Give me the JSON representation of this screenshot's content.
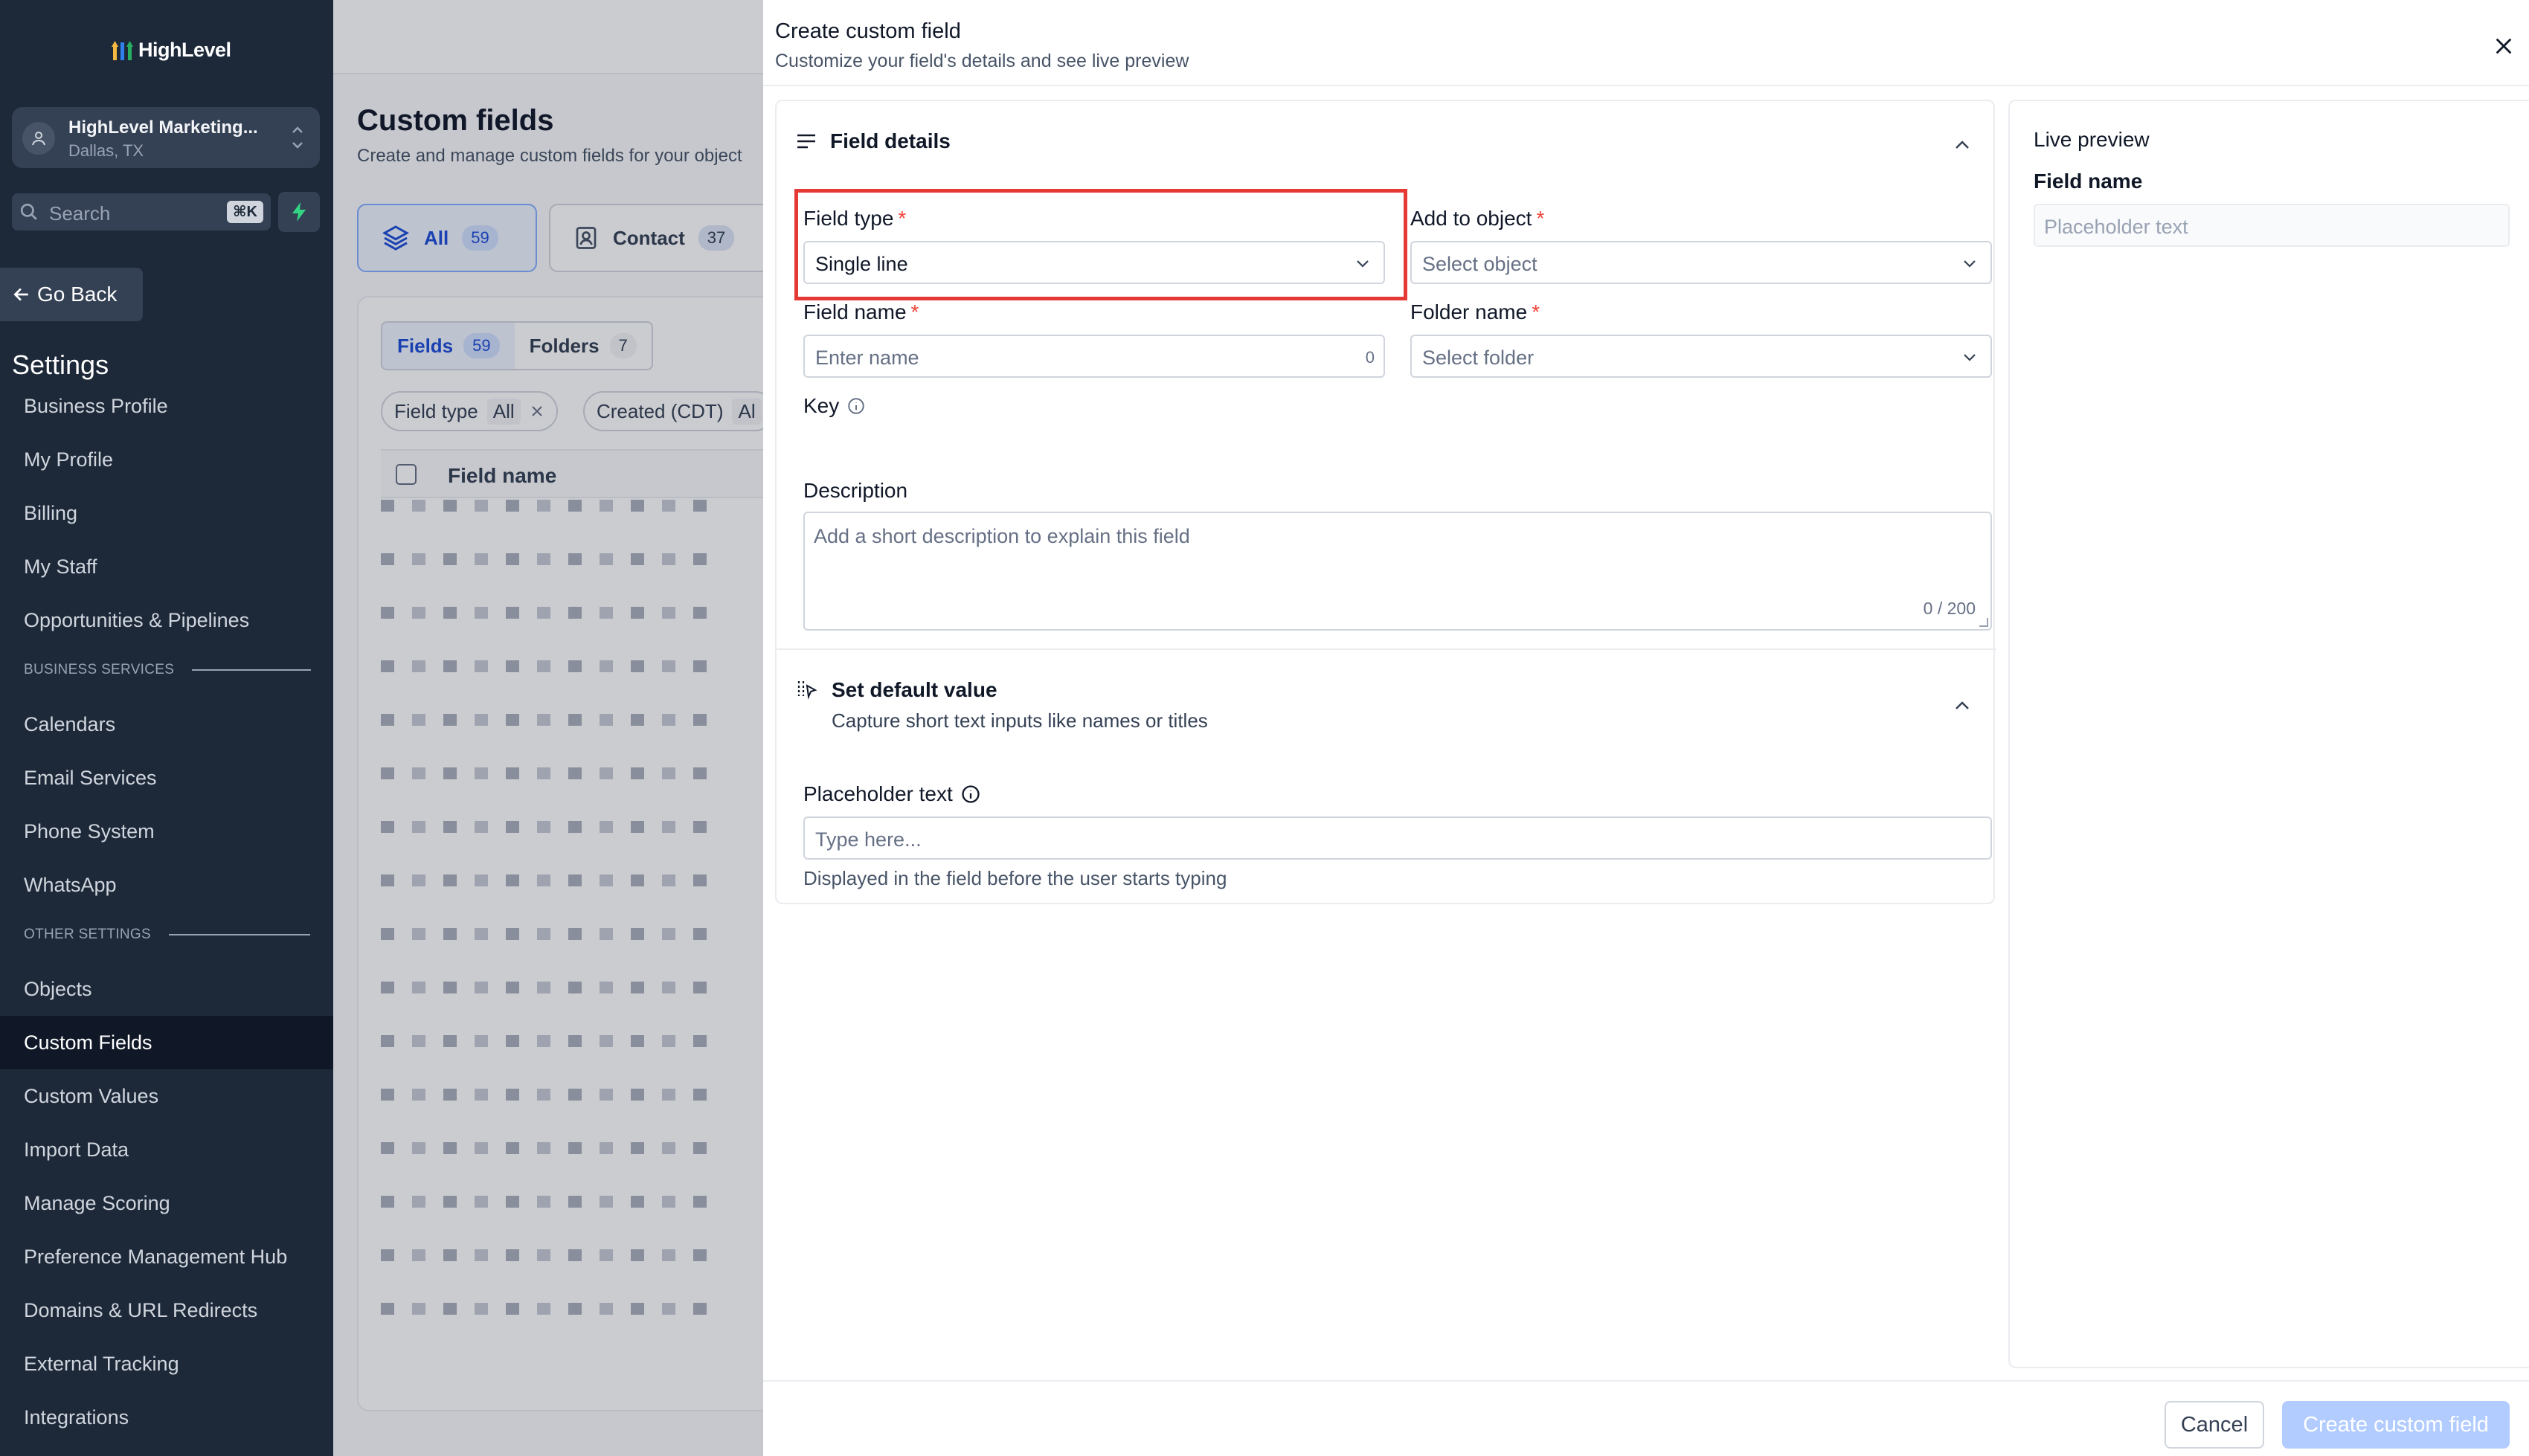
{
  "sidebar": {
    "logo": "HighLevel",
    "account": {
      "name": "HighLevel Marketing...",
      "location": "Dallas, TX"
    },
    "search": {
      "placeholder": "Search",
      "shortcut": "⌘K"
    },
    "go_back": "Go Back",
    "settings_title": "Settings",
    "items_top": [
      "Business Profile",
      "My Profile",
      "Billing",
      "My Staff",
      "Opportunities & Pipelines"
    ],
    "section_business": "BUSINESS SERVICES",
    "items_business": [
      "Calendars",
      "Email Services",
      "Phone System",
      "WhatsApp"
    ],
    "section_other": "OTHER SETTINGS",
    "items_other": [
      "Objects",
      "Custom Fields",
      "Custom Values",
      "Import Data",
      "Manage Scoring",
      "Preference Management Hub",
      "Domains & URL Redirects",
      "External Tracking",
      "Integrations"
    ],
    "active_item": "Custom Fields"
  },
  "main": {
    "title": "Custom fields",
    "subtitle": "Create and manage custom fields for your object",
    "tabs": [
      {
        "label": "All",
        "count": "59"
      },
      {
        "label": "Contact",
        "count": "37"
      }
    ],
    "segments": [
      {
        "label": "Fields",
        "count": "59"
      },
      {
        "label": "Folders",
        "count": "7"
      }
    ],
    "filters": [
      {
        "label": "Field type",
        "value": "All"
      },
      {
        "label": "Created (CDT)",
        "value": "Al"
      }
    ],
    "table_header": "Field name"
  },
  "drawer": {
    "title": "Create custom field",
    "subtitle": "Customize your field's details and see live preview",
    "details_section": "Field details",
    "field_type": {
      "label": "Field type",
      "value": "Single line"
    },
    "add_to_object": {
      "label": "Add to object",
      "placeholder": "Select object"
    },
    "field_name": {
      "label": "Field name",
      "placeholder": "Enter name",
      "count": "0"
    },
    "folder_name": {
      "label": "Folder name",
      "placeholder": "Select folder"
    },
    "key_label": "Key",
    "description": {
      "label": "Description",
      "placeholder": "Add a short description to explain this field",
      "count": "0 / 200"
    },
    "default_section": {
      "title": "Set default value",
      "subtitle": "Capture short text inputs like names or titles"
    },
    "placeholder_text": {
      "label": "Placeholder text",
      "placeholder": "Type here...",
      "helper": "Displayed in the field before the user starts typing"
    },
    "preview": {
      "title": "Live preview",
      "field_label": "Field name",
      "input_placeholder": "Placeholder text"
    },
    "cancel": "Cancel",
    "create": "Create custom field"
  },
  "colors": {
    "sidebar_bg": "#1d2939",
    "accent": "#1d4ed8",
    "highlight_box": "#e53935",
    "required": "#f04438",
    "create_disabled": "#b2ccff"
  }
}
